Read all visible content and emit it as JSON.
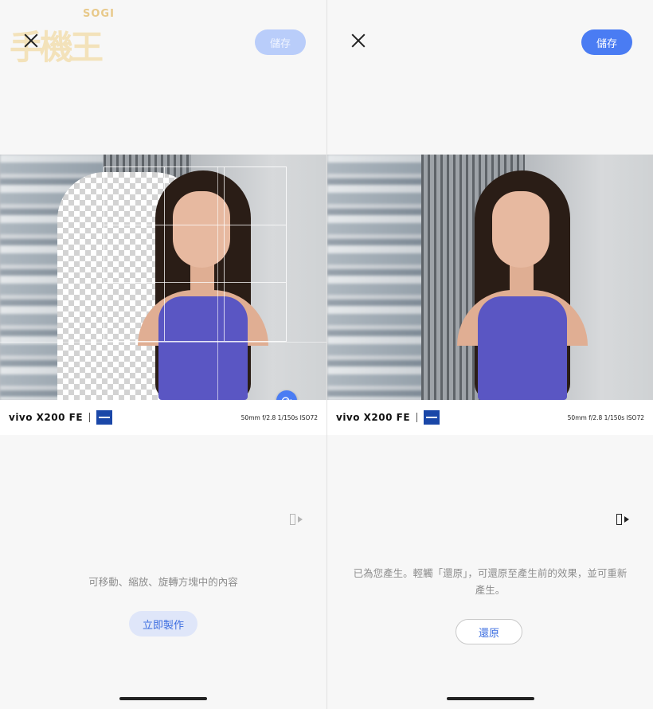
{
  "left_panel": {
    "save_label": "儲存",
    "brand": "vivo X200 FE",
    "specs": "50mm  f/2.8  1/150s  ISO72",
    "hint": "可移動、縮放、旋轉方塊中的內容",
    "make_label": "立即製作",
    "logo_text": "SOGI",
    "logo_chars": "手機王"
  },
  "right_panel": {
    "save_label": "儲存",
    "brand": "vivo X200 FE",
    "specs": "50mm  f/2.8  1/150s  ISO72",
    "hint": "已為您產生。輕觸「還原」，可還原至產生前的效果，並可重新產生。",
    "restore_label": "還原"
  },
  "colors": {
    "accent": "#4a7cf3",
    "accent_disabled": "#b9cdfa",
    "person_top": "#5a56c3"
  },
  "icons": [
    "close-icon",
    "rotate-icon",
    "mirror-icon",
    "zeiss-logo"
  ]
}
